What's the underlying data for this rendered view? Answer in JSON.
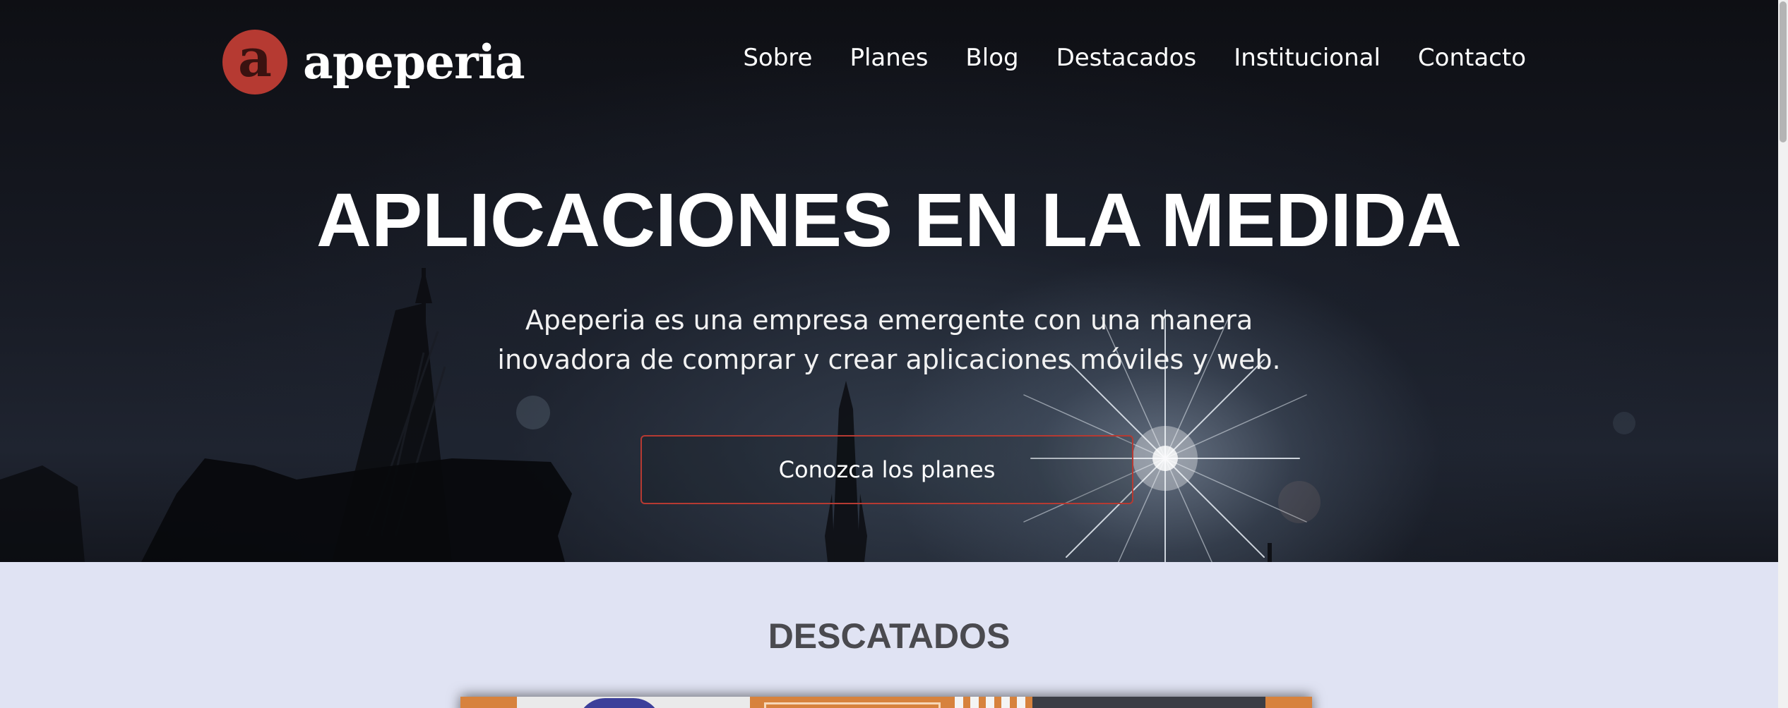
{
  "brand": {
    "mark_letter": "a",
    "name": "apeperia",
    "mark_color": "#b63a32"
  },
  "nav": {
    "items": [
      "Sobre",
      "Planes",
      "Blog",
      "Destacados",
      "Institucional",
      "Contacto"
    ]
  },
  "hero": {
    "title": "APLICACIONES EN LA MEDIDA",
    "subtitle_lines": [
      "Apeperia es una empresa emergente con una manera",
      "inovadora de comprar y crear aplicaciones móviles y web."
    ],
    "cta_label": "Conozca los planes",
    "accent_color": "#b63a32"
  },
  "featured": {
    "title": "DESCATADOS",
    "background_color": "#e0e3f3"
  }
}
